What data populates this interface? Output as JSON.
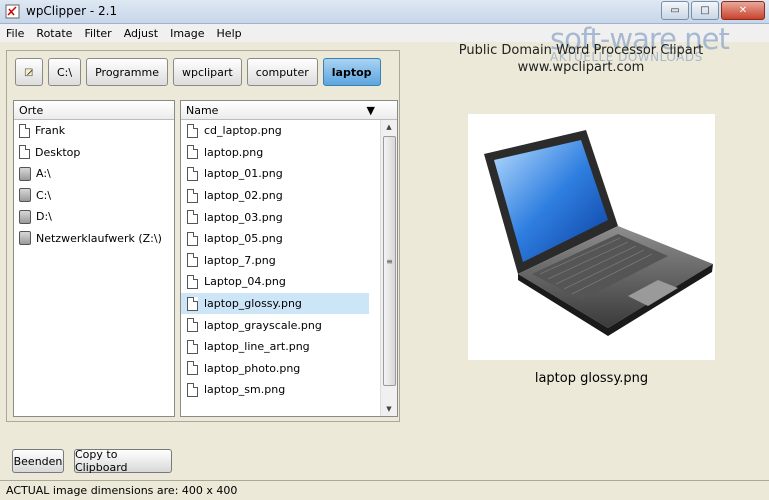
{
  "window": {
    "title": "wpClipper - 2.1",
    "min_label": "▭",
    "max_label": "□",
    "close_label": "✕"
  },
  "menu": {
    "items": [
      {
        "label": "File",
        "accel": "F"
      },
      {
        "label": "Rotate",
        "accel": ""
      },
      {
        "label": "Filter",
        "accel": ""
      },
      {
        "label": "Adjust",
        "accel": ""
      },
      {
        "label": "Image",
        "accel": "I"
      },
      {
        "label": "Help",
        "accel": "H"
      }
    ]
  },
  "path": {
    "items": [
      "C:\\",
      "Programme",
      "wpclipart",
      "computer",
      "laptop"
    ],
    "active": "laptop"
  },
  "places": {
    "header": "Orte",
    "items": [
      {
        "label": "Frank",
        "icon": "file-icon"
      },
      {
        "label": "Desktop",
        "icon": "file-icon"
      },
      {
        "label": "A:\\",
        "icon": "drive-icon"
      },
      {
        "label": "C:\\",
        "icon": "drive-icon"
      },
      {
        "label": "D:\\",
        "icon": "drive-icon"
      },
      {
        "label": "Netzwerklaufwerk (Z:\\)",
        "icon": "drive-icon"
      }
    ]
  },
  "files": {
    "header": "Name",
    "sort_icon": "sort-desc-icon",
    "selected": "laptop_glossy.png",
    "items": [
      "cd_laptop.png",
      "laptop.png",
      "laptop_01.png",
      "laptop_02.png",
      "laptop_03.png",
      "laptop_05.png",
      "laptop_7.png",
      "Laptop_04.png",
      "laptop_glossy.png",
      "laptop_grayscale.png",
      "laptop_line_art.png",
      "laptop_photo.png",
      "laptop_sm.png"
    ]
  },
  "watermark": {
    "main": "soft-ware.net",
    "sub": "AKTUELLE DOWNLOADS"
  },
  "source": {
    "line1": "Public Domain Word Processor Clipart",
    "line2": "www.wpclipart.com"
  },
  "preview": {
    "caption": "laptop glossy.png",
    "image_icon": "laptop-image"
  },
  "buttons": {
    "quit": "Beenden",
    "copy": "Copy to Clipboard"
  },
  "status": {
    "text": "ACTUAL image dimensions are: 400 x 400"
  },
  "colors": {
    "selected_row": "#cde6f7",
    "active_path": "#5ca5df",
    "watermark": "#9ab0cc"
  }
}
